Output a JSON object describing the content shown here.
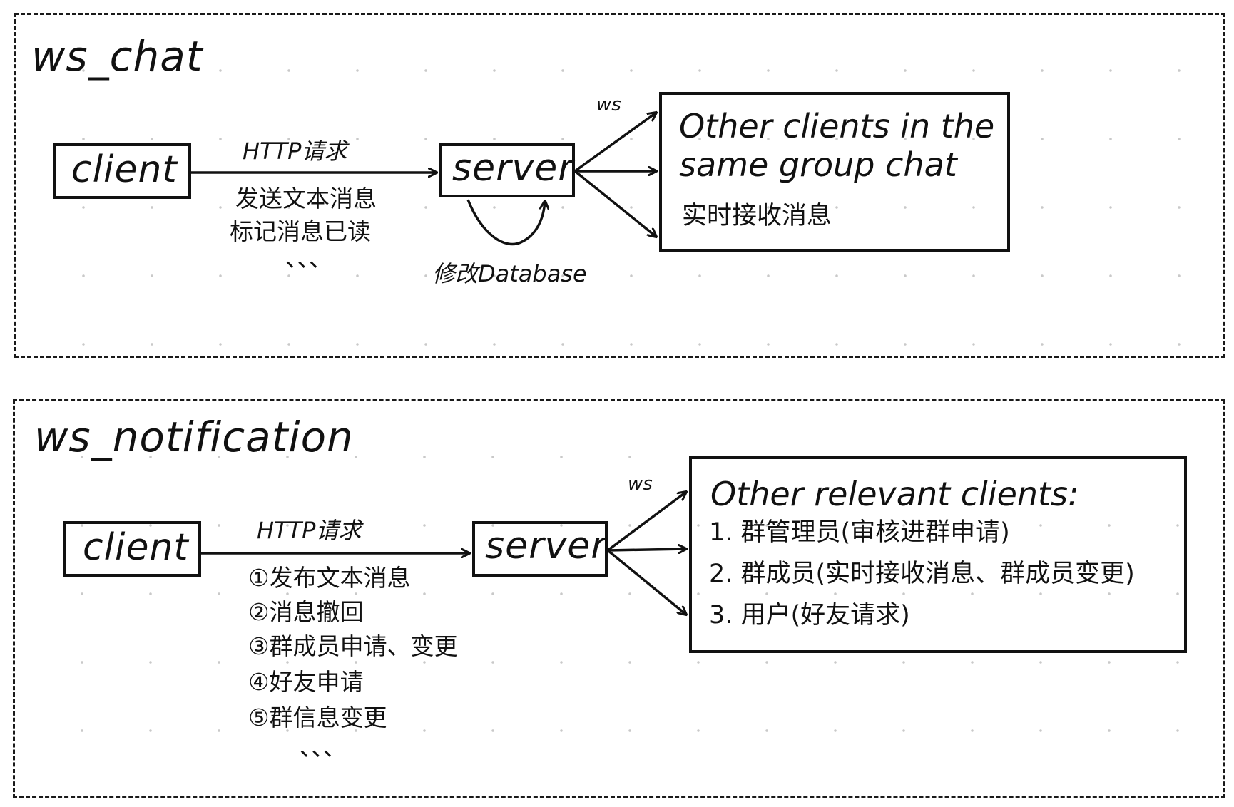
{
  "chat": {
    "title": "ws_chat",
    "client_label": "client",
    "server_label": "server",
    "http_label": "HTTP请求",
    "http_items": [
      "发送文本消息",
      "标记消息已读",
      "、、、"
    ],
    "ws_label": "ws",
    "loop_label": "修改Database",
    "target": {
      "line1": "Other clients in the",
      "line2": "same group chat",
      "desc": "实时接收消息"
    }
  },
  "notification": {
    "title": "ws_notification",
    "client_label": "client",
    "server_label": "server",
    "http_label": "HTTP请求",
    "http_items": [
      "①发布文本消息",
      "②消息撤回",
      "③群成员申请、变更",
      "④好友申请",
      "⑤群信息变更",
      "、、、"
    ],
    "ws_label": "ws",
    "target": {
      "heading": "Other relevant clients:",
      "items": [
        "1. 群管理员(审核进群申请)",
        "2. 群成员(实时接收消息、群成员变更)",
        "3. 用户(好友请求)"
      ]
    }
  }
}
